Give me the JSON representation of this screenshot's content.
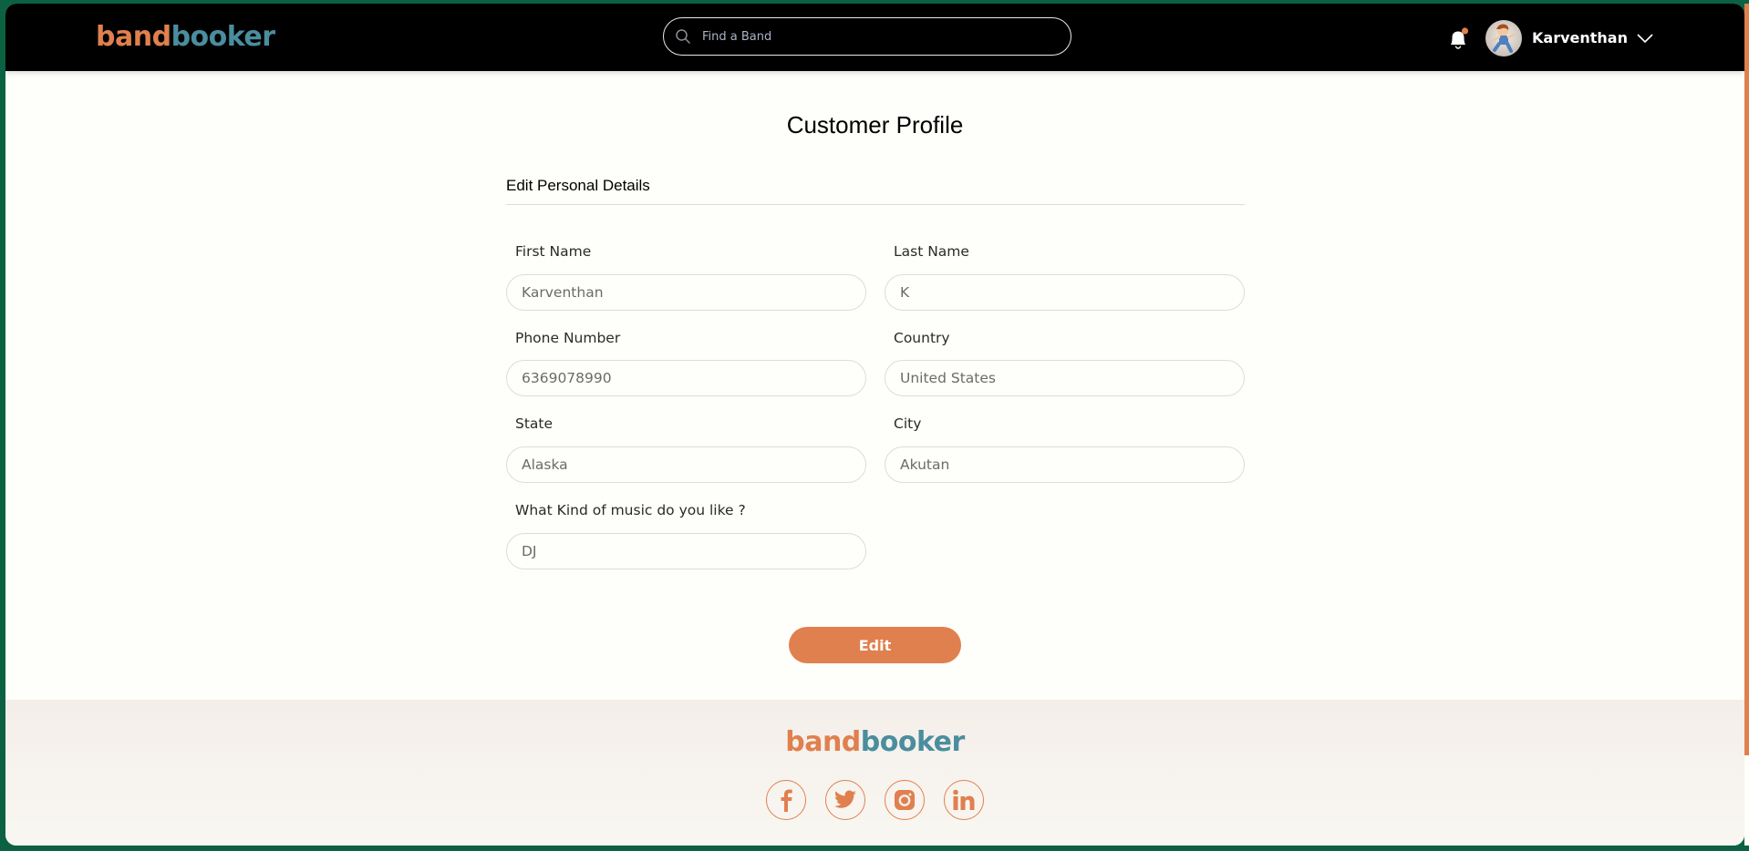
{
  "brand": {
    "part1": "band",
    "part2": "booker",
    "color_primary": "#e0804e",
    "color_secondary": "#4a8e9e"
  },
  "header": {
    "search_placeholder": "Find a Band",
    "user_name": "Karventhan",
    "notification_dot": true,
    "icons": {
      "search": "search-icon",
      "bell": "bell-icon",
      "chevron": "chevron-down-icon"
    }
  },
  "page": {
    "title": "Customer Profile",
    "section_label": "Edit Personal Details"
  },
  "form": {
    "fields": [
      {
        "label": "First Name",
        "value": "Karventhan"
      },
      {
        "label": "Last Name",
        "value": "K"
      },
      {
        "label": "Phone Number",
        "value": "6369078990"
      },
      {
        "label": "Country",
        "value": "United States"
      },
      {
        "label": "State",
        "value": "Alaska"
      },
      {
        "label": "City",
        "value": "Akutan"
      },
      {
        "label": "What Kind of music do you like ?",
        "value": "DJ"
      }
    ],
    "submit_label": "Edit"
  },
  "footer": {
    "social": [
      "facebook",
      "twitter",
      "instagram",
      "linkedin"
    ]
  },
  "colors": {
    "accent": "#e0804e",
    "frame": "#0b6141",
    "header_bg": "#000000"
  }
}
